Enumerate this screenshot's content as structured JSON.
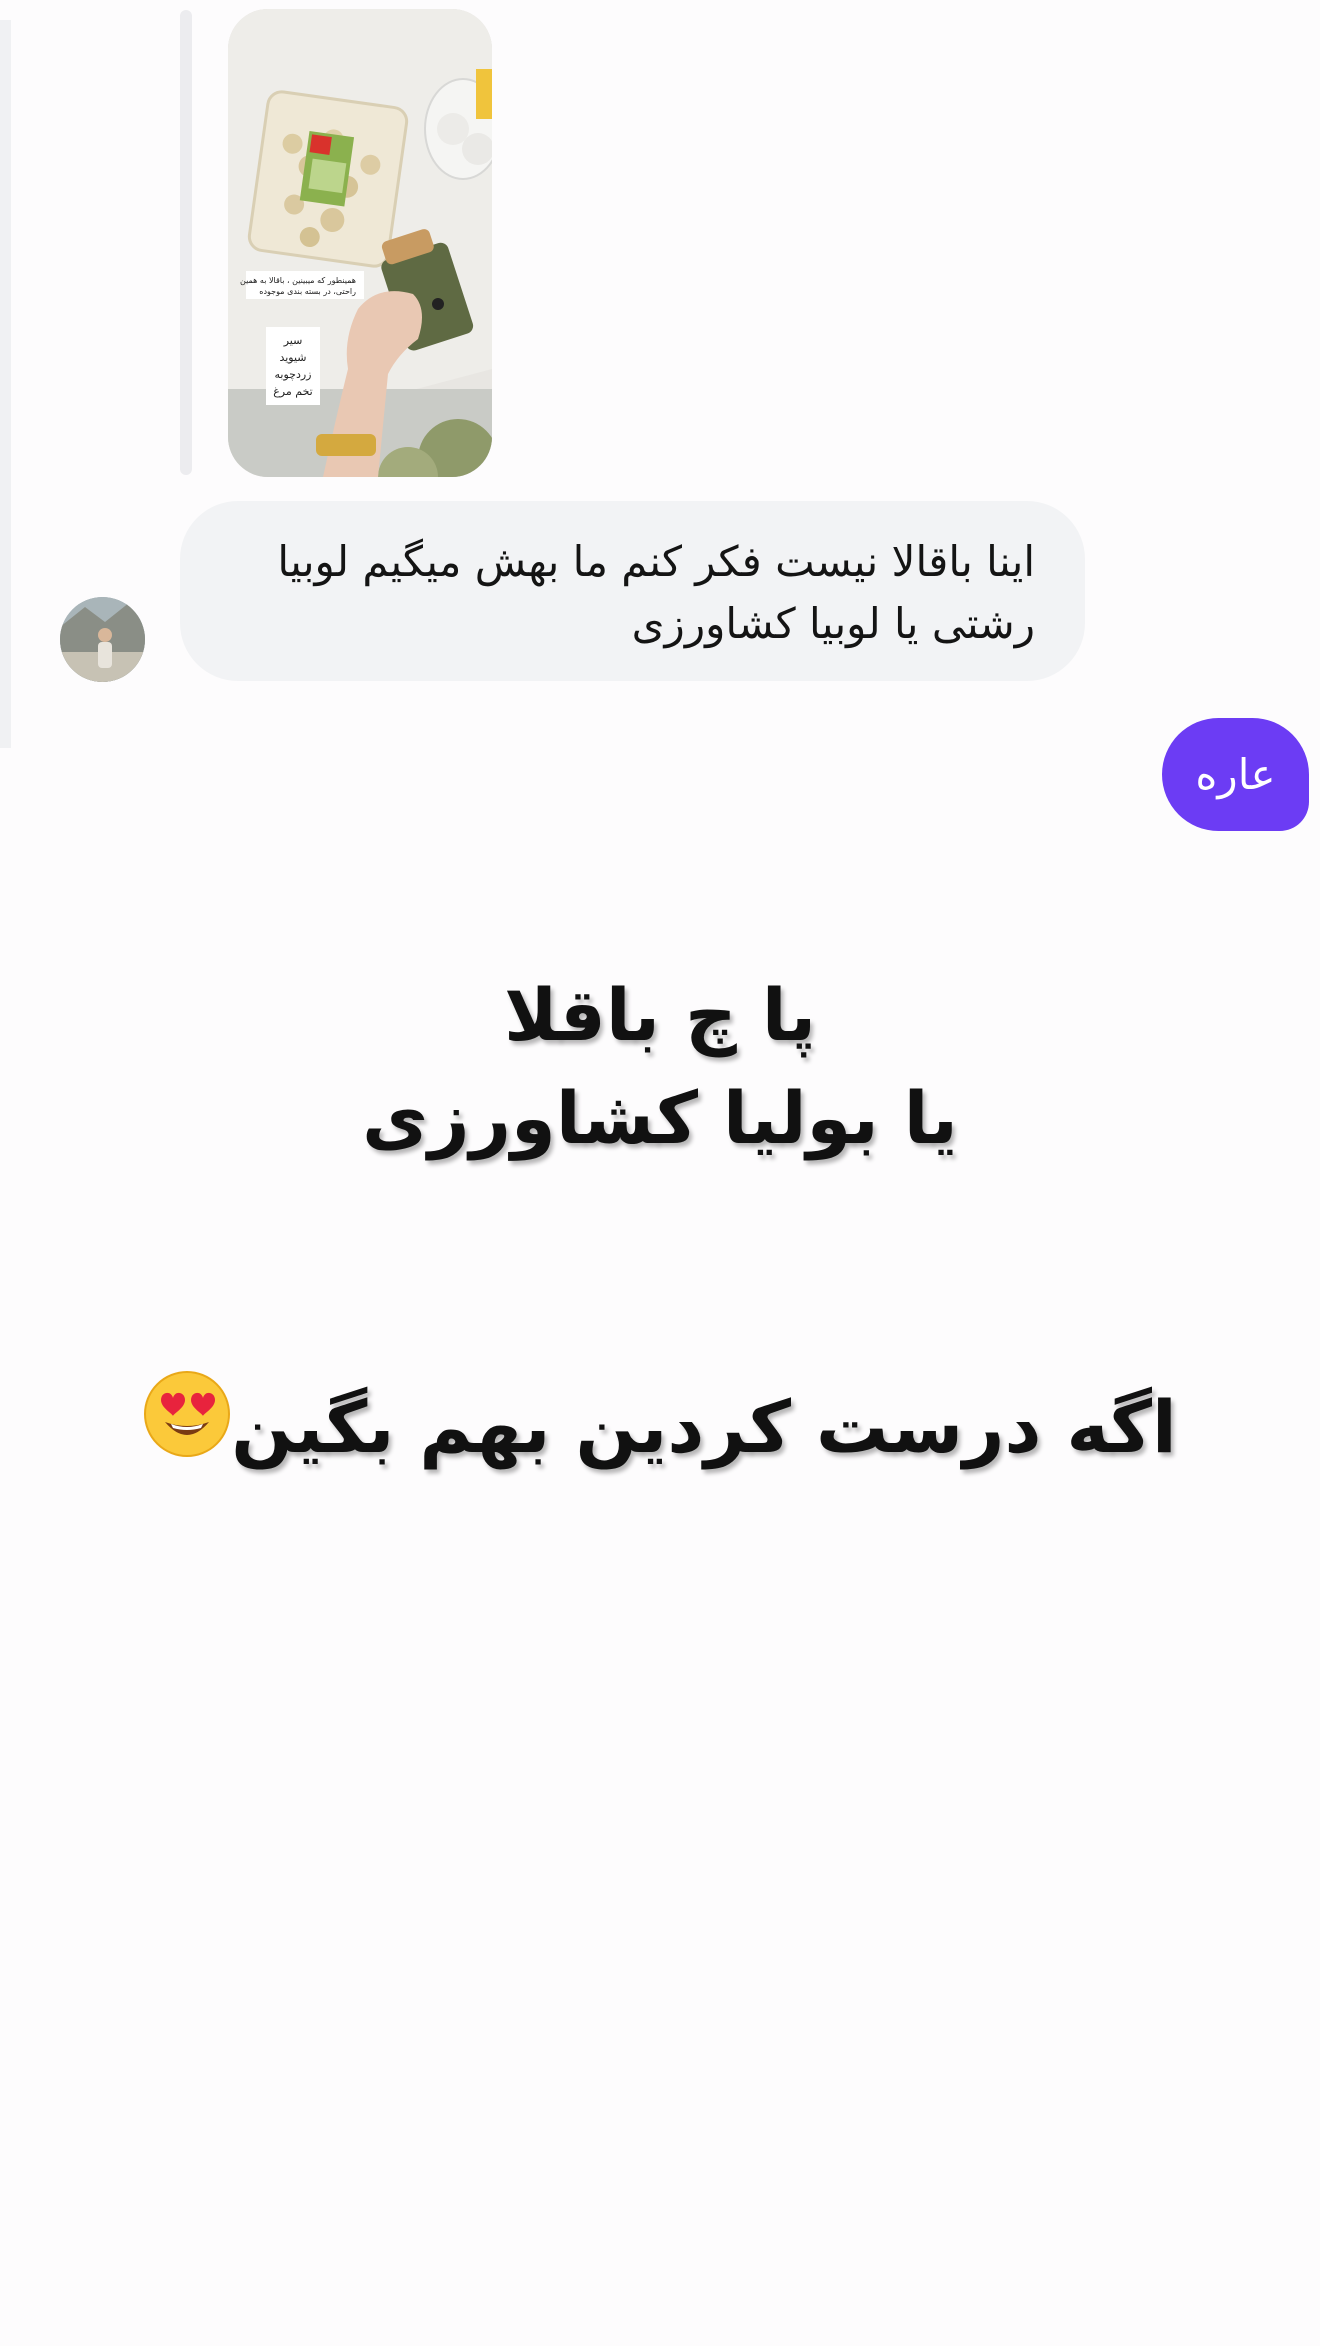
{
  "chat": {
    "story_reply": {
      "image_label": "",
      "story_text_1": "همینطور که میبینین ، باقالا به همین راحتی، در بسته بندی موجوده",
      "story_text_2": [
        "سیر",
        "شیوید",
        "زردچوبه",
        "تخم مرغ"
      ]
    },
    "incoming_message": {
      "line_1": "اینا باقالا نیست فکر  کنم ما بهش میگیم لوبیا",
      "line_2": "رشتی یا لوبیا کشاورزی"
    },
    "outgoing_message": {
      "text": "عاره",
      "color": "#6c3cf4"
    }
  },
  "overlay_text": {
    "line_1": "پا چ باقلا",
    "line_2": "یا بولیا کشاورزی",
    "line_3": "اگه درست کردین بهم بگین",
    "emoji": "heart-eyes-emoji"
  }
}
